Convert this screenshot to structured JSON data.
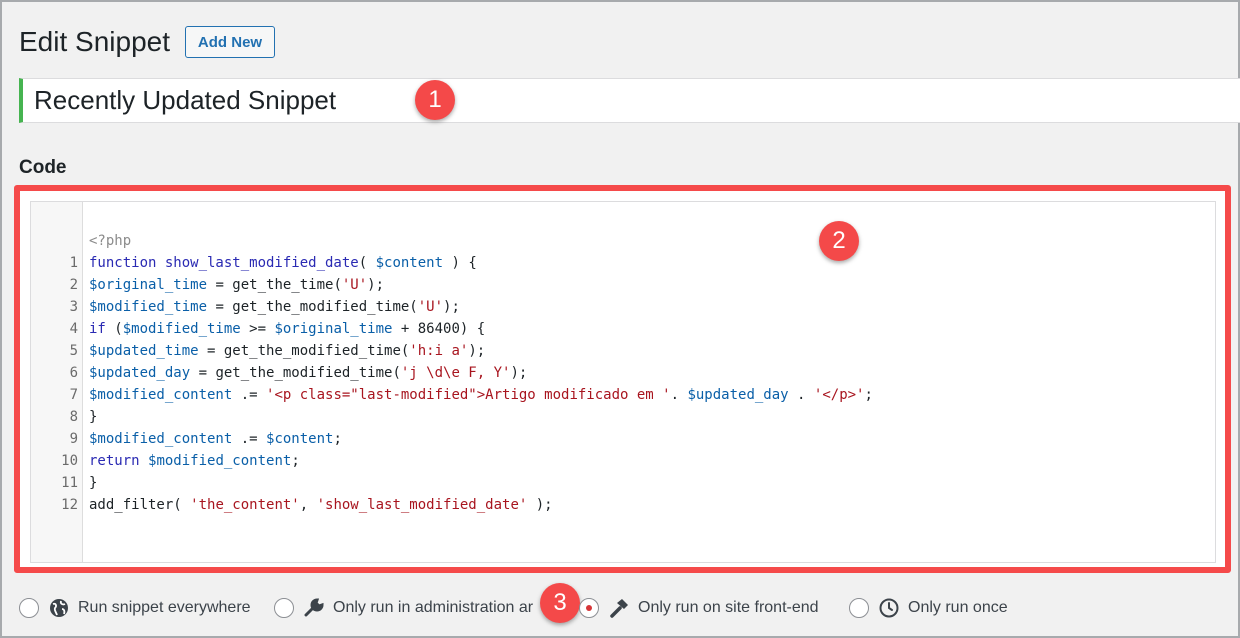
{
  "header": {
    "title": "Edit Snippet",
    "add_new_label": "Add New"
  },
  "snippet": {
    "title": "Recently Updated Snippet",
    "code_label": "Code",
    "header_comment": "<?php",
    "lines": [
      {
        "n": "1",
        "tokens": [
          [
            "kw",
            "function "
          ],
          [
            "kw",
            "show_last_modified_date"
          ],
          [
            "plain",
            "( "
          ],
          [
            "var",
            "$content"
          ],
          [
            "plain",
            " ) {"
          ]
        ]
      },
      {
        "n": "2",
        "tokens": [
          [
            "var",
            "$original_time"
          ],
          [
            "plain",
            " = get_the_time("
          ],
          [
            "str",
            "'U'"
          ],
          [
            "plain",
            ");"
          ]
        ]
      },
      {
        "n": "3",
        "tokens": [
          [
            "var",
            "$modified_time"
          ],
          [
            "plain",
            " = get_the_modified_time("
          ],
          [
            "str",
            "'U'"
          ],
          [
            "plain",
            ");"
          ]
        ]
      },
      {
        "n": "4",
        "tokens": [
          [
            "kw",
            "if"
          ],
          [
            "plain",
            " ("
          ],
          [
            "var",
            "$modified_time"
          ],
          [
            "plain",
            " >= "
          ],
          [
            "var",
            "$original_time"
          ],
          [
            "plain",
            " + 86400) {"
          ]
        ]
      },
      {
        "n": "5",
        "tokens": [
          [
            "var",
            "$updated_time"
          ],
          [
            "plain",
            " = get_the_modified_time("
          ],
          [
            "str",
            "'h:i a'"
          ],
          [
            "plain",
            ");"
          ]
        ]
      },
      {
        "n": "6",
        "tokens": [
          [
            "var",
            "$updated_day"
          ],
          [
            "plain",
            " = get_the_modified_time("
          ],
          [
            "str",
            "'j \\d\\e F, Y'"
          ],
          [
            "plain",
            ");"
          ]
        ]
      },
      {
        "n": "7",
        "tokens": [
          [
            "var",
            "$modified_content"
          ],
          [
            "plain",
            " .= "
          ],
          [
            "str",
            "'<p class=\"last-modified\">Artigo modificado em '"
          ],
          [
            "plain",
            ". "
          ],
          [
            "var",
            "$updated_day"
          ],
          [
            "plain",
            " . "
          ],
          [
            "str",
            "'</p>'"
          ],
          [
            "plain",
            ";"
          ]
        ]
      },
      {
        "n": "8",
        "tokens": [
          [
            "plain",
            "}"
          ]
        ]
      },
      {
        "n": "9",
        "tokens": [
          [
            "var",
            "$modified_content"
          ],
          [
            "plain",
            " .= "
          ],
          [
            "var",
            "$content"
          ],
          [
            "plain",
            ";"
          ]
        ]
      },
      {
        "n": "10",
        "tokens": [
          [
            "kw",
            "return"
          ],
          [
            "plain",
            " "
          ],
          [
            "var",
            "$modified_content"
          ],
          [
            "plain",
            ";"
          ]
        ]
      },
      {
        "n": "11",
        "tokens": [
          [
            "plain",
            "}"
          ]
        ]
      },
      {
        "n": "12",
        "tokens": [
          [
            "plain",
            "add_filter( "
          ],
          [
            "str",
            "'the_content'"
          ],
          [
            "plain",
            ", "
          ],
          [
            "str",
            "'show_last_modified_date'"
          ],
          [
            "plain",
            " );"
          ]
        ]
      }
    ]
  },
  "annotations": {
    "badge1": "1",
    "badge2": "2",
    "badge3": "3"
  },
  "scope_options": [
    {
      "label": "Run snippet everywhere",
      "icon": "globe-icon",
      "checked": false
    },
    {
      "label": "Only run in administration ar",
      "icon": "wrench-icon",
      "checked": false
    },
    {
      "label": "Only run on site front-end",
      "icon": "hammer-icon",
      "checked": true
    },
    {
      "label": "Only run once",
      "icon": "clock-icon",
      "checked": false
    }
  ],
  "colors": {
    "highlight_border": "#f54a4a",
    "title_accent": "#46b450",
    "link": "#2271b1"
  }
}
